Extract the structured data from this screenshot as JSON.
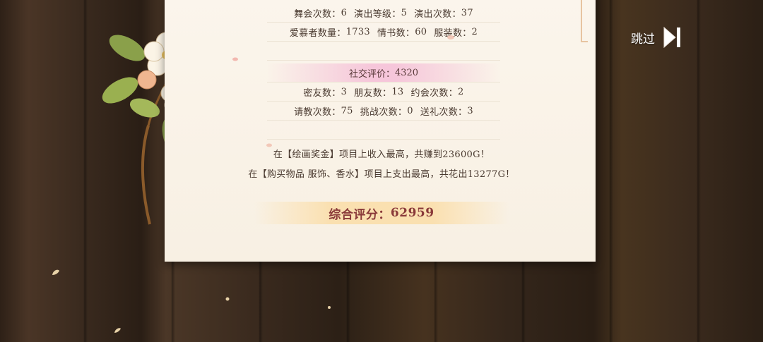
{
  "stats": {
    "row1": {
      "dance_label": "舞会次数：",
      "dance_value": "6",
      "perf_level_label": "演出等级：",
      "perf_level_value": "5",
      "perf_count_label": "演出次数：",
      "perf_count_value": "37"
    },
    "row2": {
      "admirers_label": "爱慕者数量：",
      "admirers_value": "1733",
      "letters_label": "情书数：",
      "letters_value": "60",
      "outfits_label": "服装数：",
      "outfits_value": "2"
    },
    "social_rating_label": "社交评价：",
    "social_rating_value": "4320",
    "row3": {
      "bestie_label": "密友数：",
      "bestie_value": "3",
      "friends_label": "朋友数：",
      "friends_value": "13",
      "dates_label": "约会次数：",
      "dates_value": "2"
    },
    "row4": {
      "lessons_label": "请教次数：",
      "lessons_value": "75",
      "challenge_label": "挑战次数：",
      "challenge_value": "0",
      "gifts_label": "送礼次数：",
      "gifts_value": "3"
    }
  },
  "summary": {
    "income_line": "在【绘画奖金】项目上收入最高，共赚到23600G！",
    "expense_line": "在【购买物品 服饰、香水】项目上支出最高，共花出13277G！"
  },
  "overall": {
    "label": "综合评分：",
    "value": "62959"
  },
  "skip": {
    "label": "跳过",
    "icon": "skip-forward-icon"
  },
  "decor": {
    "flower_icon": "apple-blossom-icon"
  }
}
